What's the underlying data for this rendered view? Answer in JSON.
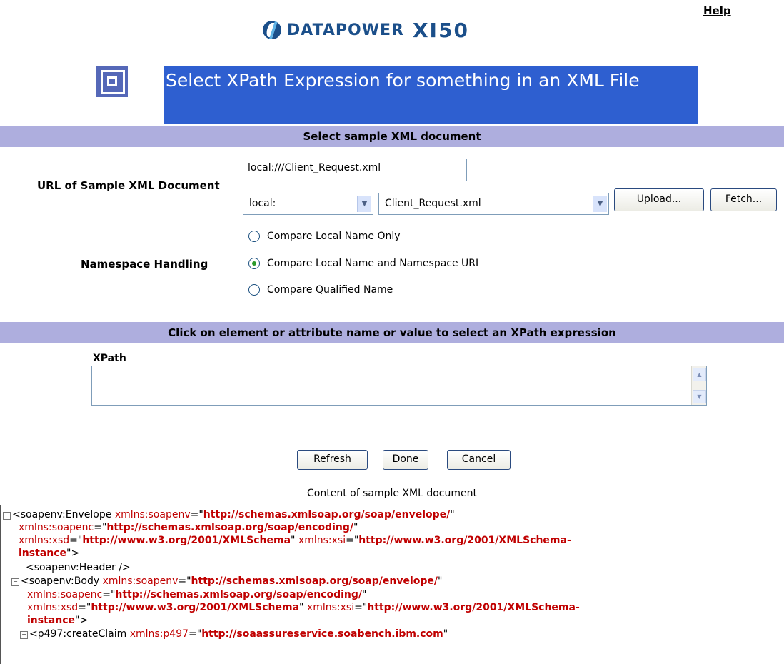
{
  "header": {
    "help_label": "Help",
    "brand": "DATAPOWER",
    "model": "XI50",
    "page_title": "Select XPath Expression for something in an XML File"
  },
  "section1": {
    "title": "Select sample XML document",
    "url_label": "URL of Sample XML Document",
    "url_value": "local:///Client_Request.xml",
    "dir_select": "local:",
    "file_select": "Client_Request.xml",
    "upload_label": "Upload...",
    "fetch_label": "Fetch...",
    "ns_label": "Namespace Handling",
    "ns_options": [
      {
        "label": "Compare Local Name Only",
        "selected": false
      },
      {
        "label": "Compare Local Name and Namespace URI",
        "selected": true
      },
      {
        "label": "Compare Qualified Name",
        "selected": false
      }
    ]
  },
  "section2": {
    "title": "Click on element or attribute name or value to select an XPath expression",
    "xpath_label": "XPath",
    "xpath_value": "",
    "refresh_label": "Refresh",
    "done_label": "Done",
    "cancel_label": "Cancel",
    "content_caption": "Content of sample XML document"
  },
  "xml": {
    "toggle": "−",
    "l1": {
      "tag": "<soapenv:Envelope ",
      "a1": "xmlns:soapenv",
      "eq": "=\"",
      "v1": "http://schemas.xmlsoap.org/soap/envelope/",
      "q": "\""
    },
    "l2": {
      "a": "xmlns:soapenc",
      "eq": "=\"",
      "v": "http://schemas.xmlsoap.org/soap/encoding/",
      "q": "\""
    },
    "l3": {
      "a1": "xmlns:xsd",
      "eq1": "=\"",
      "v1": "http://www.w3.org/2001/XMLSchema",
      "q1": "\" ",
      "a2": "xmlns:xsi",
      "eq2": "=\"",
      "v2": "http://www.w3.org/2001/XMLSchema-"
    },
    "l4": {
      "v": "instance",
      "close": "\">"
    },
    "l5": {
      "tag": "<soapenv:Header />"
    },
    "l6": {
      "tag": "<soapenv:Body ",
      "a1": "xmlns:soapenv",
      "eq": "=\"",
      "v1": "http://schemas.xmlsoap.org/soap/envelope/",
      "q": "\""
    },
    "l7": {
      "a": "xmlns:soapenc",
      "eq": "=\"",
      "v": "http://schemas.xmlsoap.org/soap/encoding/",
      "q": "\""
    },
    "l8": {
      "a1": "xmlns:xsd",
      "eq1": "=\"",
      "v1": "http://www.w3.org/2001/XMLSchema",
      "q1": "\" ",
      "a2": "xmlns:xsi",
      "eq2": "=\"",
      "v2": "http://www.w3.org/2001/XMLSchema-"
    },
    "l9": {
      "v": "instance",
      "close": "\">"
    },
    "l10": {
      "tag": "<p497:createClaim ",
      "a1": "xmlns:p497",
      "eq": "=\"",
      "v1": "http://soaassureservice.soabench.ibm.com",
      "q": "\""
    }
  }
}
